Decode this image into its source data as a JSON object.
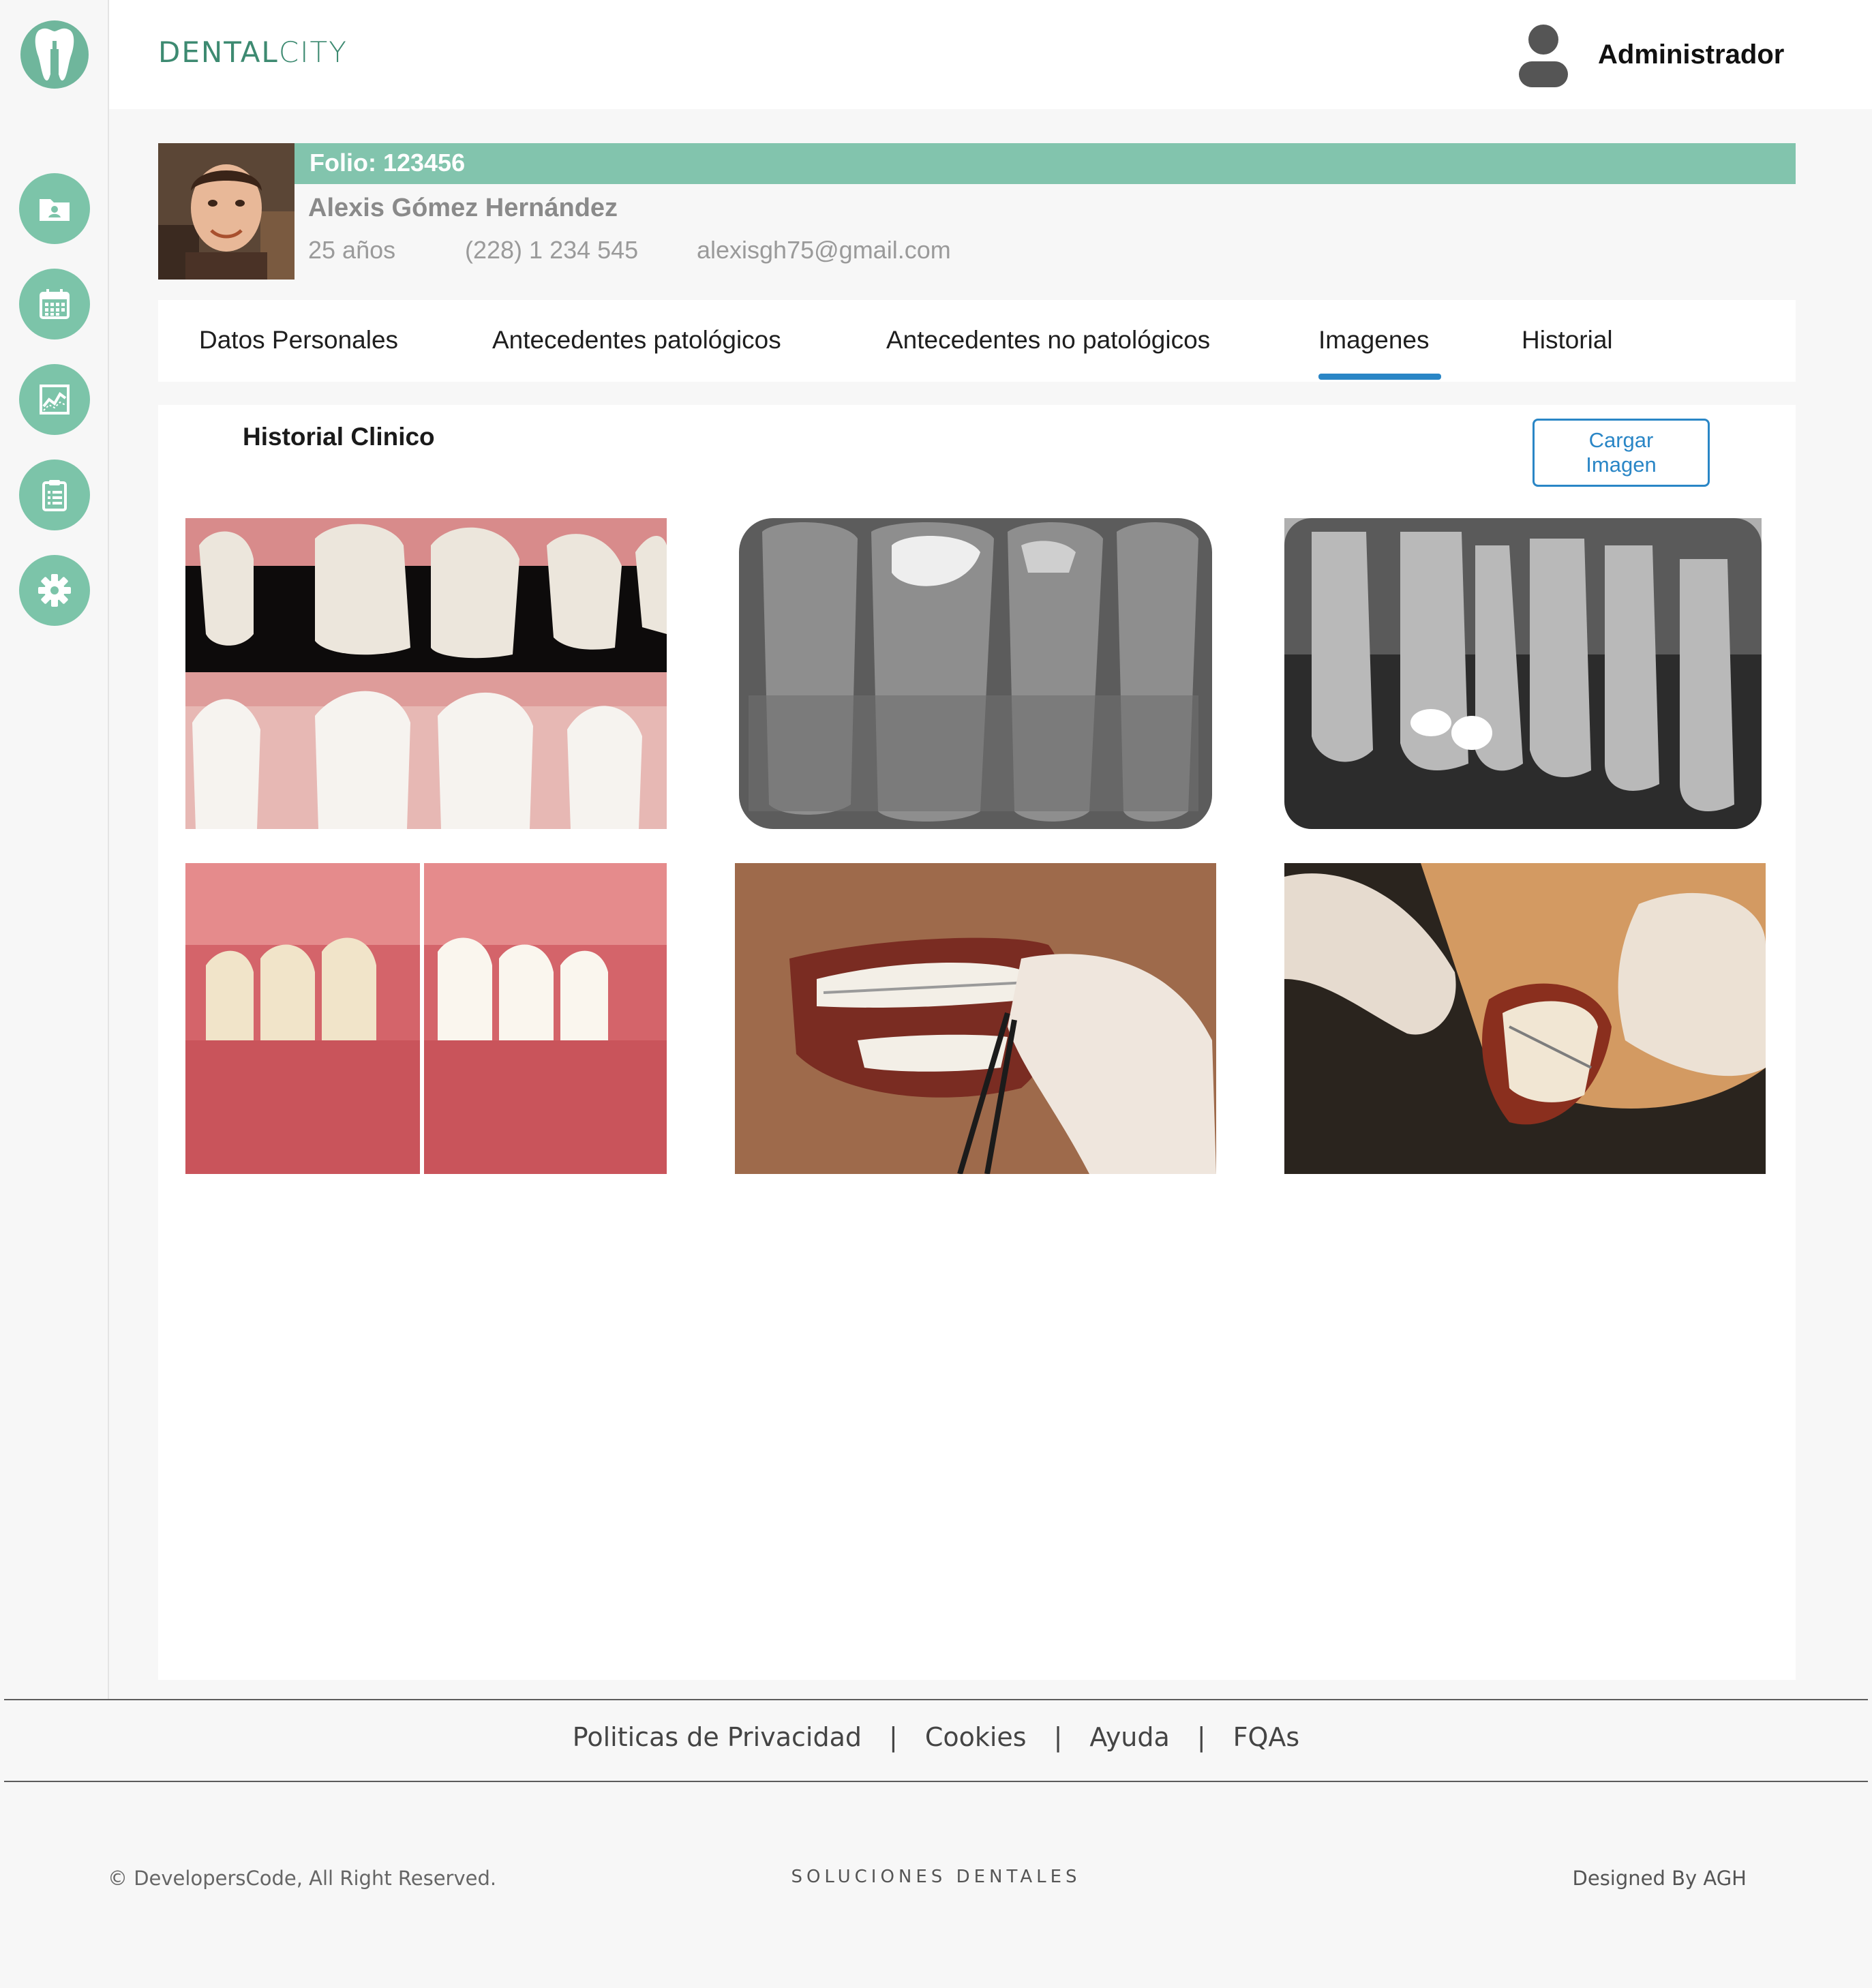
{
  "app": {
    "brand_primary": "DENTAL",
    "brand_secondary": "CITY",
    "user_name": "Administrador",
    "accent_color": "#82c4ad",
    "link_color": "#2a86c6"
  },
  "sidebar": {
    "items": [
      {
        "icon": "patient-folder-icon"
      },
      {
        "icon": "calendar-icon"
      },
      {
        "icon": "chart-icon"
      },
      {
        "icon": "clipboard-icon"
      },
      {
        "icon": "gear-icon"
      }
    ]
  },
  "patient": {
    "folio": "Folio: 123456",
    "name": "Alexis Gómez Hernández",
    "age": "25 años",
    "phone": "(228) 1 234 545",
    "email": "alexisgh75@gmail.com"
  },
  "tabs": [
    {
      "label": "Datos Personales",
      "active": false
    },
    {
      "label": "Antecedentes patológicos",
      "active": false
    },
    {
      "label": "Antecedentes no patológicos",
      "active": false
    },
    {
      "label": "Imagenes",
      "active": true
    },
    {
      "label": "Historial",
      "active": false
    }
  ],
  "panel": {
    "title": "Historial Clinico",
    "upload_label_1": "Cargar",
    "upload_label_2": "Imagen",
    "images": [
      {
        "kind": "teeth-before-after-photo"
      },
      {
        "kind": "dental-xray-bitewing"
      },
      {
        "kind": "dental-xray-periapical"
      },
      {
        "kind": "smile-comparison-photo"
      },
      {
        "kind": "braces-adjustment-photo"
      },
      {
        "kind": "braces-procedure-photo"
      }
    ]
  },
  "footer": {
    "links": [
      "Politicas de Privacidad",
      "Cookies",
      "Ayuda",
      "FQAs"
    ],
    "separator": "|",
    "copyright": "© DevelopersCode, All Right Reserved.",
    "tagline": "SOLUCIONES DENTALES",
    "designed_by": "Designed By AGH"
  }
}
